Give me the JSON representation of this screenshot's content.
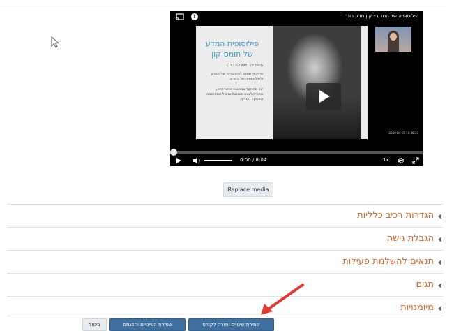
{
  "video": {
    "title": "פילוסופיה של המדע - קון מדע בוגר",
    "slide_title": "פילוסופית המדע של תומס קון",
    "slide_p1": "תומס קון (1922-1996)",
    "slide_p2": "פיזיקאי שפנה להיסטוריה של המדע ולפילוסופיה של המדע.",
    "slide_p3": "קון מתמקד בנסיבות החברתיות, הפסיכולוגיות והמנטליות של התפתחות המחקר המדעי.",
    "timestamp": "2020-04-15 10:36:33",
    "current_time": "0:00",
    "duration": "/ 8:04",
    "speed": "1x",
    "progress": 0.0,
    "icons": [
      "cast-icon",
      "info-icon",
      "play-icon",
      "volume-icon",
      "gear-icon",
      "fullscreen-icon"
    ]
  },
  "replace_media_label": "Replace media",
  "sections": [
    {
      "label": "הגדרות רכיב כלליות"
    },
    {
      "label": "הגבלת גישה"
    },
    {
      "label": "תנאים להשלמת פעילות"
    },
    {
      "label": "תגים"
    },
    {
      "label": "מיומנויות"
    }
  ],
  "buttons": {
    "save_return": "שמירת שינויים וחזרה לקורס",
    "save_display": "שמירת השינויים והצגתם",
    "cancel": "ביטול"
  },
  "colors": {
    "section_text": "#d9682b",
    "primary_button": "#3f6f9e",
    "annotation_arrow": "#e03a32"
  }
}
